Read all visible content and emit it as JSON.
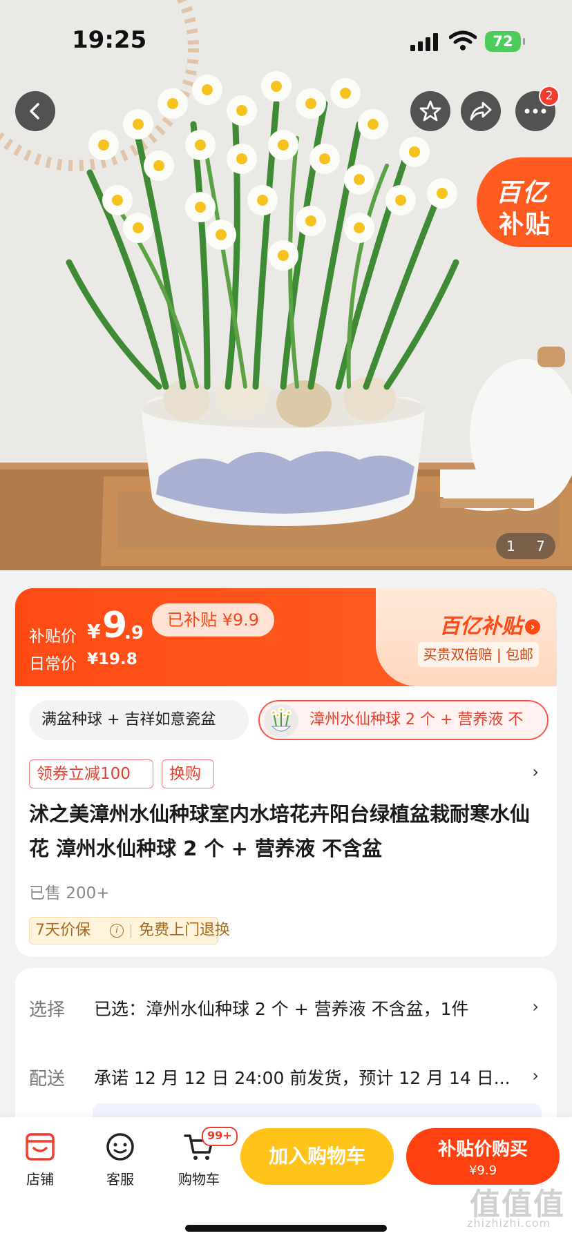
{
  "status_bar": {
    "time": "19:25",
    "battery": "72"
  },
  "hero": {
    "subsidy_tag_line1": "百亿",
    "subsidy_tag_line2": "补贴",
    "image_index": "1",
    "image_total": "7",
    "more_badge": "2"
  },
  "price": {
    "subsidy_label": "补贴价",
    "yen": "¥",
    "int": "9",
    "dec": ".9",
    "daily_label": "日常价",
    "daily_value": "¥19.8",
    "badge": "已补贴 ¥9.9",
    "brand": "百亿补贴",
    "guarantee": "买贵双倍赔 | 包邮",
    "colors": {
      "accent": "#ff4a16",
      "badge_bg": "#ffe2d3"
    }
  },
  "sku": {
    "option_a": "满盆种球 + 吉祥如意瓷盆",
    "option_b": "漳州水仙种球 2 个 + 营养液  不"
  },
  "coupons": [
    "领券立减100",
    "换购"
  ],
  "product": {
    "title": "沭之美漳州水仙种球室内水培花卉阳台绿植盆栽耐寒水仙花 漳州水仙种球 2 个 + 营养液  不含盆",
    "sold": "已售 200+",
    "service_1": "7天价保",
    "service_2": "免费上门退换"
  },
  "options": {
    "select_label": "选择",
    "select_value": "已选：漳州水仙种球 2 个 + 营养液  不含盆，1件",
    "ship_label": "配送",
    "ship_value": "承诺 12 月 12 日 24:00 前发货，预计 12 月 14 日..."
  },
  "bottom": {
    "shop": "店铺",
    "service": "客服",
    "cart": "购物车",
    "cart_badge": "99+",
    "add_cart": "加入购物车",
    "buy_line1": "补贴价购买",
    "buy_line2": "¥9.9"
  },
  "watermark": {
    "main": "值值值",
    "sub": "zhizhizhi.com"
  }
}
